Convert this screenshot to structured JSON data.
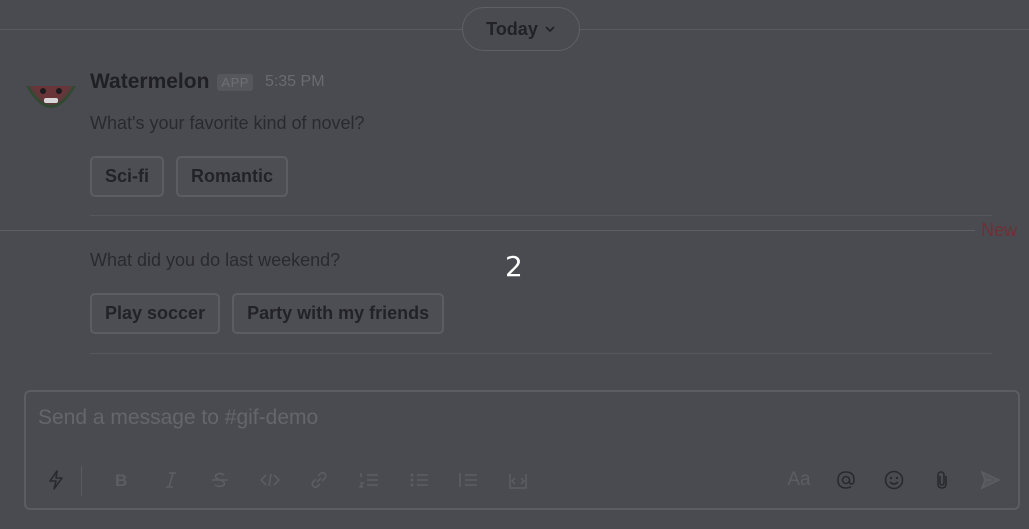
{
  "divider": {
    "label": "Today"
  },
  "message": {
    "sender": "Watermelon",
    "badge": "APP",
    "time": "5:35 PM",
    "blocks": [
      {
        "text": "What's your favorite kind of novel?",
        "buttons": [
          "Sci-fi",
          "Romantic"
        ]
      },
      {
        "text": "What did you do last weekend?",
        "buttons": [
          "Play soccer",
          "Party with my friends"
        ]
      }
    ]
  },
  "new_marker": "New",
  "overlay_number": "2",
  "composer": {
    "placeholder": "Send a message to #gif-demo",
    "format_label": "Aa"
  },
  "icons": {
    "shortcuts": "lightning-icon",
    "bold": "bold-icon",
    "italic": "italic-icon",
    "strike": "strikethrough-icon",
    "code": "code-icon",
    "link": "link-icon",
    "ordered": "ordered-list-icon",
    "bullet": "bullet-list-icon",
    "quote": "blockquote-icon",
    "codeblock": "code-block-icon",
    "mention": "at-mention-icon",
    "emoji": "emoji-icon",
    "attach": "paperclip-icon",
    "send": "send-icon"
  },
  "colors": {
    "background": "#4a4b51",
    "new_marker": "#6f2f35",
    "overlay_number": "#ffffff"
  }
}
